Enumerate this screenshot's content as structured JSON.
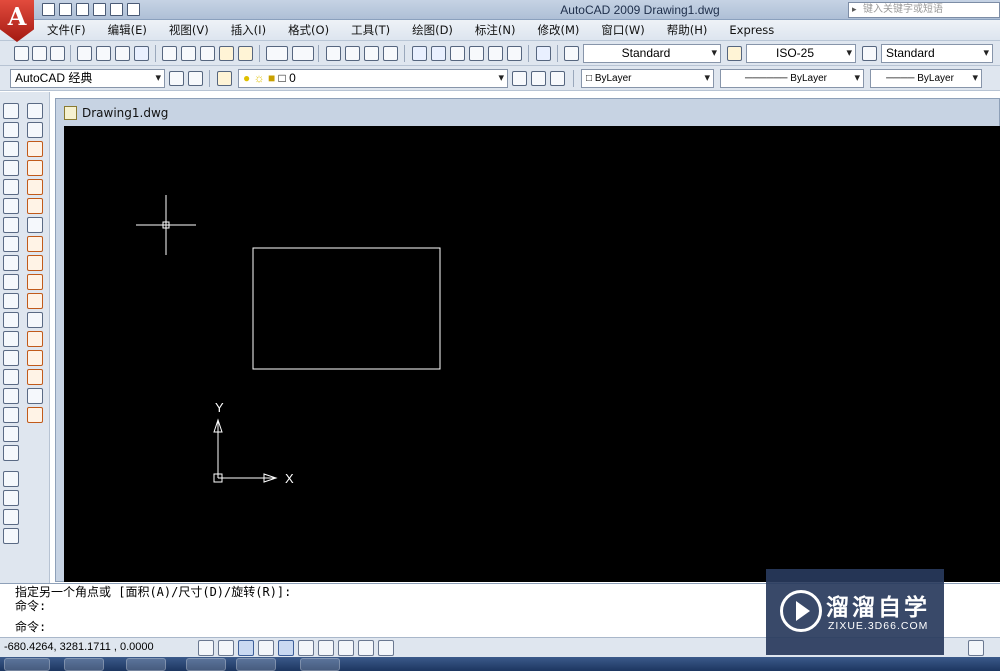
{
  "app": {
    "logo_letter": "A",
    "window_title": "AutoCAD 2009 Drawing1.dwg",
    "help_search_placeholder": "键入关键字或短语"
  },
  "menu": [
    "文件(F)",
    "编辑(E)",
    "视图(V)",
    "插入(I)",
    "格式(O)",
    "工具(T)",
    "绘图(D)",
    "标注(N)",
    "修改(M)",
    "窗口(W)",
    "帮助(H)",
    "Express"
  ],
  "toolbar": {
    "text_style": "Standard",
    "dim_style": "ISO-25",
    "table_style": "Standard",
    "workspace": "AutoCAD 经典",
    "layer": "0",
    "color": "ByLayer",
    "linetype": "ByLayer",
    "lineweight": "ByLayer"
  },
  "document": {
    "tab_title": "Drawing1.dwg"
  },
  "canvas": {
    "background": "#000000",
    "line_color": "#ffffff",
    "ucs_y_label": "Y",
    "ucs_x_label": "X"
  },
  "command_line": {
    "history_line_1": "指定另一个角点或 [面积(A)/尺寸(D)/旋转(R)]:",
    "history_line_2": "命令:",
    "prompt": "命令:",
    "input_value": ""
  },
  "status_bar": {
    "coordinates": "-680.4264,  3281.1711 , 0.0000"
  },
  "watermark": {
    "title": "溜溜自学",
    "url": "ZIXUE.3D66.COM"
  },
  "colors": {
    "accent": "#3d5f99",
    "titlebar": "#aebfd6",
    "logo_red": "#c0281c"
  }
}
